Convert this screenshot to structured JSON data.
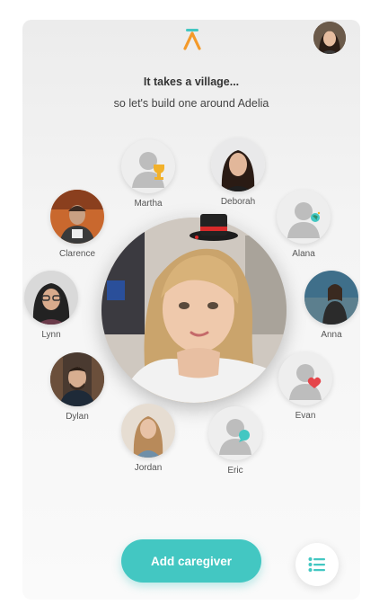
{
  "header": {
    "title": "It takes a village...",
    "subtitle": "so let's build one around Adelia"
  },
  "people": [
    {
      "name": "Martha",
      "type": "placeholder",
      "badge": "trophy-icon"
    },
    {
      "name": "Deborah",
      "type": "photo"
    },
    {
      "name": "Clarence",
      "type": "photo"
    },
    {
      "name": "Alana",
      "type": "placeholder",
      "badge": "globe-icon"
    },
    {
      "name": "Lynn",
      "type": "photo"
    },
    {
      "name": "Anna",
      "type": "photo"
    },
    {
      "name": "Dylan",
      "type": "photo"
    },
    {
      "name": "Evan",
      "type": "placeholder",
      "badge": "heart-icon"
    },
    {
      "name": "Jordan",
      "type": "photo"
    },
    {
      "name": "Eric",
      "type": "placeholder",
      "badge": "chat-icon"
    }
  ],
  "actions": {
    "add_caregiver": "Add caregiver"
  },
  "colors": {
    "accent": "#43c7c2",
    "logo_orange": "#f49a2a",
    "heart": "#e5454a"
  }
}
